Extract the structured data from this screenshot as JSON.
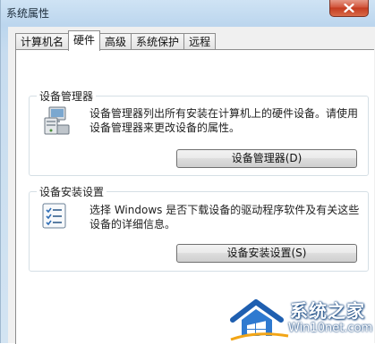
{
  "window": {
    "title": "系统属性",
    "close_icon": "close-icon"
  },
  "tabs": [
    {
      "label": "计算机名",
      "active": false
    },
    {
      "label": "硬件",
      "active": true
    },
    {
      "label": "高级",
      "active": false
    },
    {
      "label": "系统保护",
      "active": false
    },
    {
      "label": "远程",
      "active": false
    }
  ],
  "device_manager": {
    "title": "设备管理器",
    "description": "设备管理器列出所有安装在计算机上的硬件设备。请使用设备管理器来更改设备的属性。",
    "button": "设备管理器(D)",
    "icon": "device-manager-icon"
  },
  "device_installation": {
    "title": "设备安装设置",
    "description": "选择 Windows 是否下载设备的驱动程序软件及有关这些设备的详细信息。",
    "button": "设备安装设置(S)",
    "icon": "checklist-icon"
  },
  "watermark": {
    "main": "系统之家",
    "sub": "Win10net.com"
  }
}
